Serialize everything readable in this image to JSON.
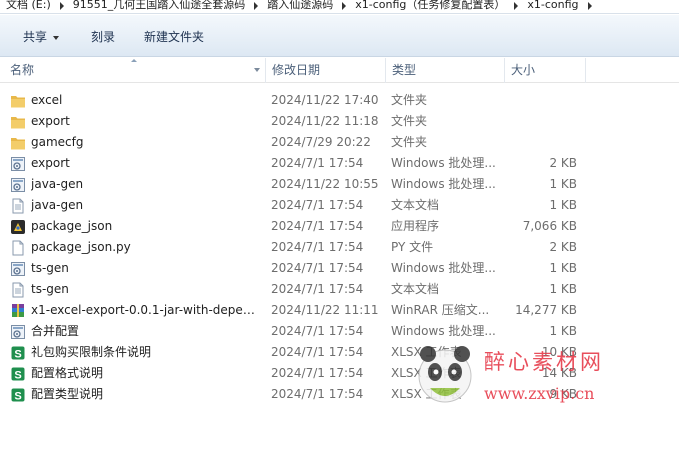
{
  "breadcrumb": [
    "文档 (E:)",
    "91551_几何王国踏入仙途全套源码",
    "踏入仙途源码",
    "x1-config（任务修复配置表）",
    "x1-config"
  ],
  "toolbar": {
    "share_label": "共享",
    "burn_label": "刻录",
    "new_folder_label": "新建文件夹"
  },
  "columns": {
    "name": "名称",
    "date": "修改日期",
    "type": "类型",
    "size": "大小"
  },
  "files": [
    {
      "name": "excel",
      "date": "2024/11/22 17:40",
      "type": "文件夹",
      "size": "",
      "icon": "folder-icon"
    },
    {
      "name": "export",
      "date": "2024/11/22 11:18",
      "type": "文件夹",
      "size": "",
      "icon": "folder-icon"
    },
    {
      "name": "gamecfg",
      "date": "2024/7/29 20:22",
      "type": "文件夹",
      "size": "",
      "icon": "folder-icon"
    },
    {
      "name": "export",
      "date": "2024/7/1 17:54",
      "type": "Windows 批处理...",
      "size": "2 KB",
      "icon": "batch-file-icon"
    },
    {
      "name": "java-gen",
      "date": "2024/11/22 10:55",
      "type": "Windows 批处理...",
      "size": "1 KB",
      "icon": "batch-file-icon"
    },
    {
      "name": "java-gen",
      "date": "2024/7/1 17:54",
      "type": "文本文档",
      "size": "1 KB",
      "icon": "text-file-icon"
    },
    {
      "name": "package_json",
      "date": "2024/7/1 17:54",
      "type": "应用程序",
      "size": "7,066 KB",
      "icon": "application-icon"
    },
    {
      "name": "package_json.py",
      "date": "2024/7/1 17:54",
      "type": "PY 文件",
      "size": "2 KB",
      "icon": "file-icon"
    },
    {
      "name": "ts-gen",
      "date": "2024/7/1 17:54",
      "type": "Windows 批处理...",
      "size": "1 KB",
      "icon": "batch-file-icon"
    },
    {
      "name": "ts-gen",
      "date": "2024/7/1 17:54",
      "type": "文本文档",
      "size": "1 KB",
      "icon": "text-file-icon"
    },
    {
      "name": "x1-excel-export-0.0.1-jar-with-depen...",
      "date": "2024/11/22 11:11",
      "type": "WinRAR 压缩文...",
      "size": "14,277 KB",
      "icon": "winrar-archive-icon"
    },
    {
      "name": "合并配置",
      "date": "2024/7/1 17:54",
      "type": "Windows 批处理...",
      "size": "1 KB",
      "icon": "batch-file-icon"
    },
    {
      "name": "礼包购买限制条件说明",
      "date": "2024/7/1 17:54",
      "type": "XLSX 工作表",
      "size": "10 KB",
      "icon": "spreadsheet-icon"
    },
    {
      "name": "配置格式说明",
      "date": "2024/7/1 17:54",
      "type": "XLSX 工作表",
      "size": "14 KB",
      "icon": "spreadsheet-icon"
    },
    {
      "name": "配置类型说明",
      "date": "2024/7/1 17:54",
      "type": "XLSX 工作表",
      "size": "9 KB",
      "icon": "spreadsheet-icon"
    }
  ],
  "watermark": {
    "name": "醉心素材网",
    "url": "www.zxvip.cn"
  },
  "colors": {
    "toolbar_top": "#f4f8fc",
    "toolbar_bottom": "#dde8f3",
    "header_text": "#4c607a",
    "detail_text": "#6d6d6d",
    "folder": "#e8b84a",
    "spreadsheet": "#1f8f4e",
    "watermark": "#e63b4a"
  }
}
